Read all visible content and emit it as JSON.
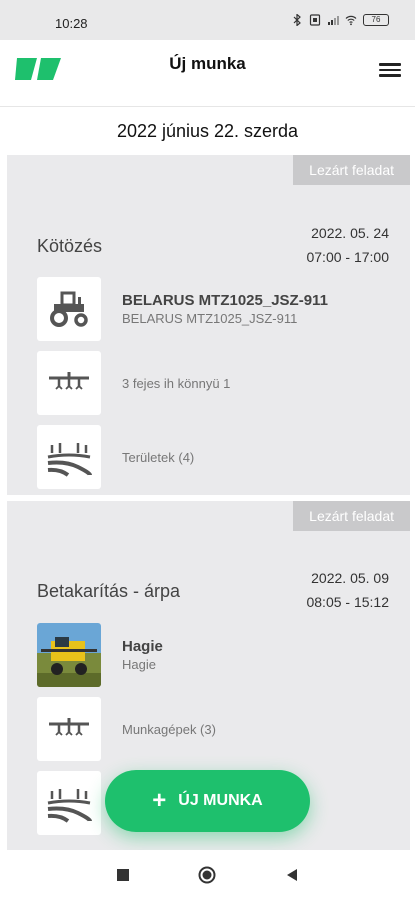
{
  "status": {
    "time": "10:28",
    "battery": "76"
  },
  "header": {
    "title": "Új munka"
  },
  "date_heading": "2022 június 22. szerda",
  "cards": [
    {
      "badge": "Lezárt feladat",
      "title": "Kötözés",
      "date": "2022. 05. 24",
      "time": "07:00 - 17:00",
      "machine_main": "BELARUS MTZ1025_JSZ-911",
      "machine_sub": "BELARUS MTZ1025_JSZ-911",
      "implement": "3 fejes ih könnyü 1",
      "fields": "Területek (4)"
    },
    {
      "badge": "Lezárt feladat",
      "title": "Betakarítás - árpa",
      "date": "2022. 05. 09",
      "time": "08:05 - 15:12",
      "machine_main": "Hagie",
      "machine_sub": "Hagie",
      "implement": "Munkagépek (3)"
    }
  ],
  "fab": {
    "label": "ÚJ MUNKA"
  },
  "colors": {
    "accent": "#1ec06d",
    "card_bg": "#eaeaec",
    "badge_bg": "#c9c9cb"
  }
}
